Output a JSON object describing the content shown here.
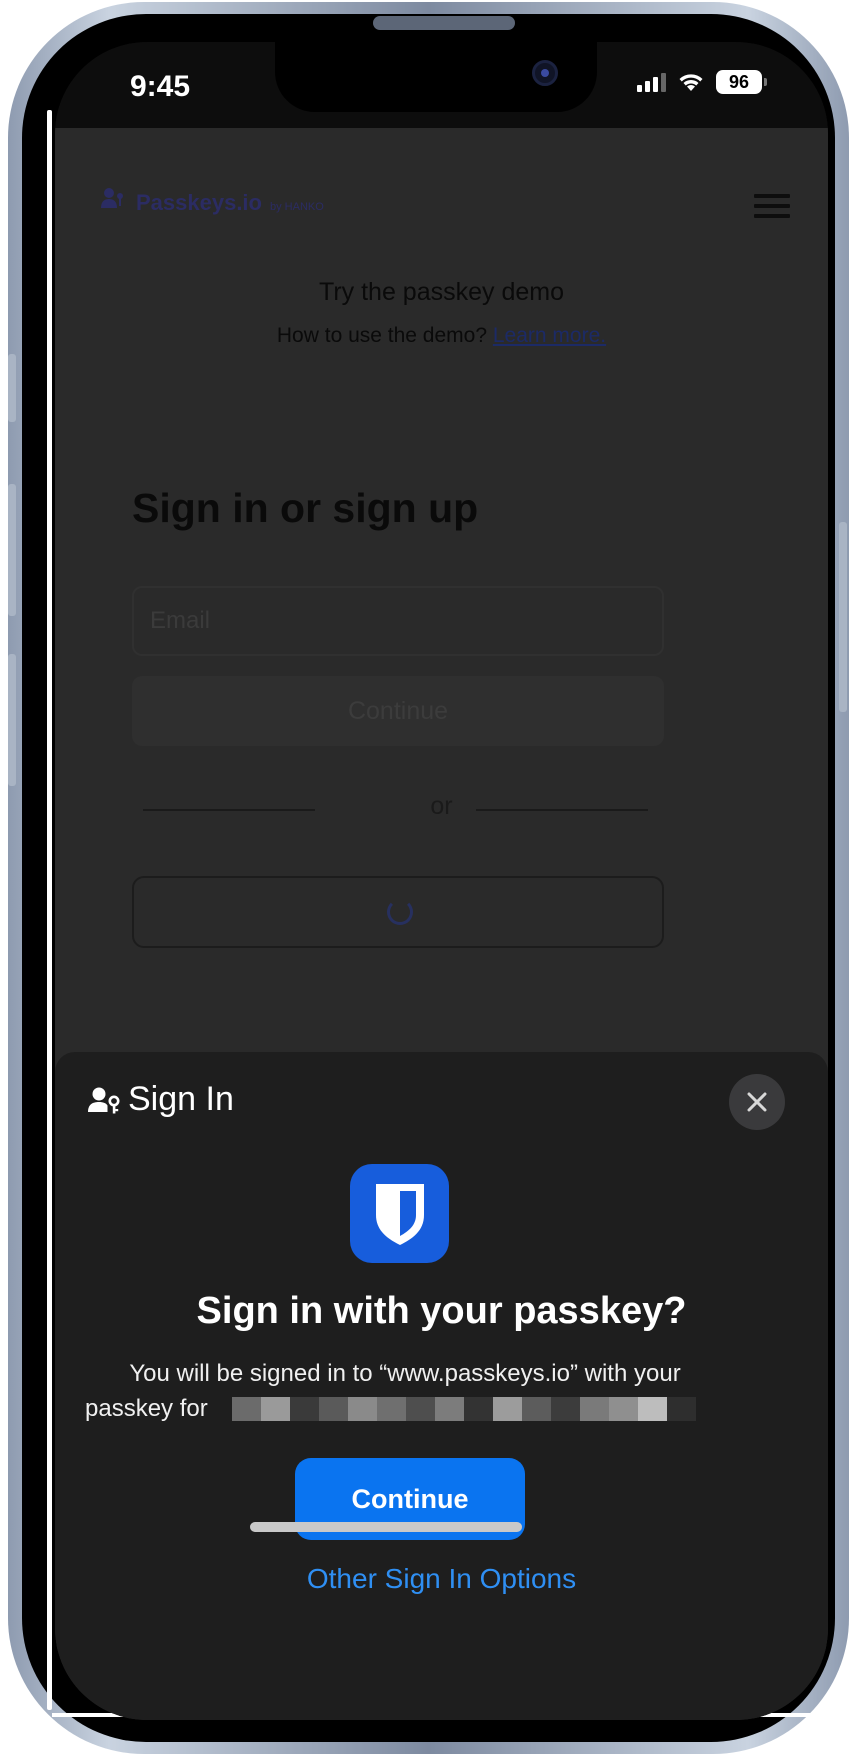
{
  "status_bar": {
    "time": "9:45",
    "battery": "96",
    "icons": [
      "signal-icon",
      "wifi-icon",
      "battery-icon"
    ]
  },
  "webpage": {
    "brand_name": "Passkeys.io",
    "brand_suffix": "by HANKO",
    "hero_title": "Try the passkey demo",
    "hero_sub_text": "How to use the demo?",
    "hero_sub_link": "Learn more.",
    "auth_title": "Sign in or sign up",
    "email_placeholder": "Email",
    "continue_label": "Continue",
    "or_label": "or"
  },
  "sheet": {
    "title": "Sign In",
    "dialog_title": "Sign in with your passkey?",
    "body_line1": "You will be signed in to “www.passkeys.io” with your",
    "body_line2": "passkey for",
    "continue_label": "Continue",
    "other_options_label": "Other Sign In Options"
  },
  "colors": {
    "accent": "#0a74f0",
    "link": "#2f8ff3",
    "app_icon": "#175ddc",
    "sheet_bg": "#1e1e1e",
    "page_dim": "#2a2a2a"
  }
}
